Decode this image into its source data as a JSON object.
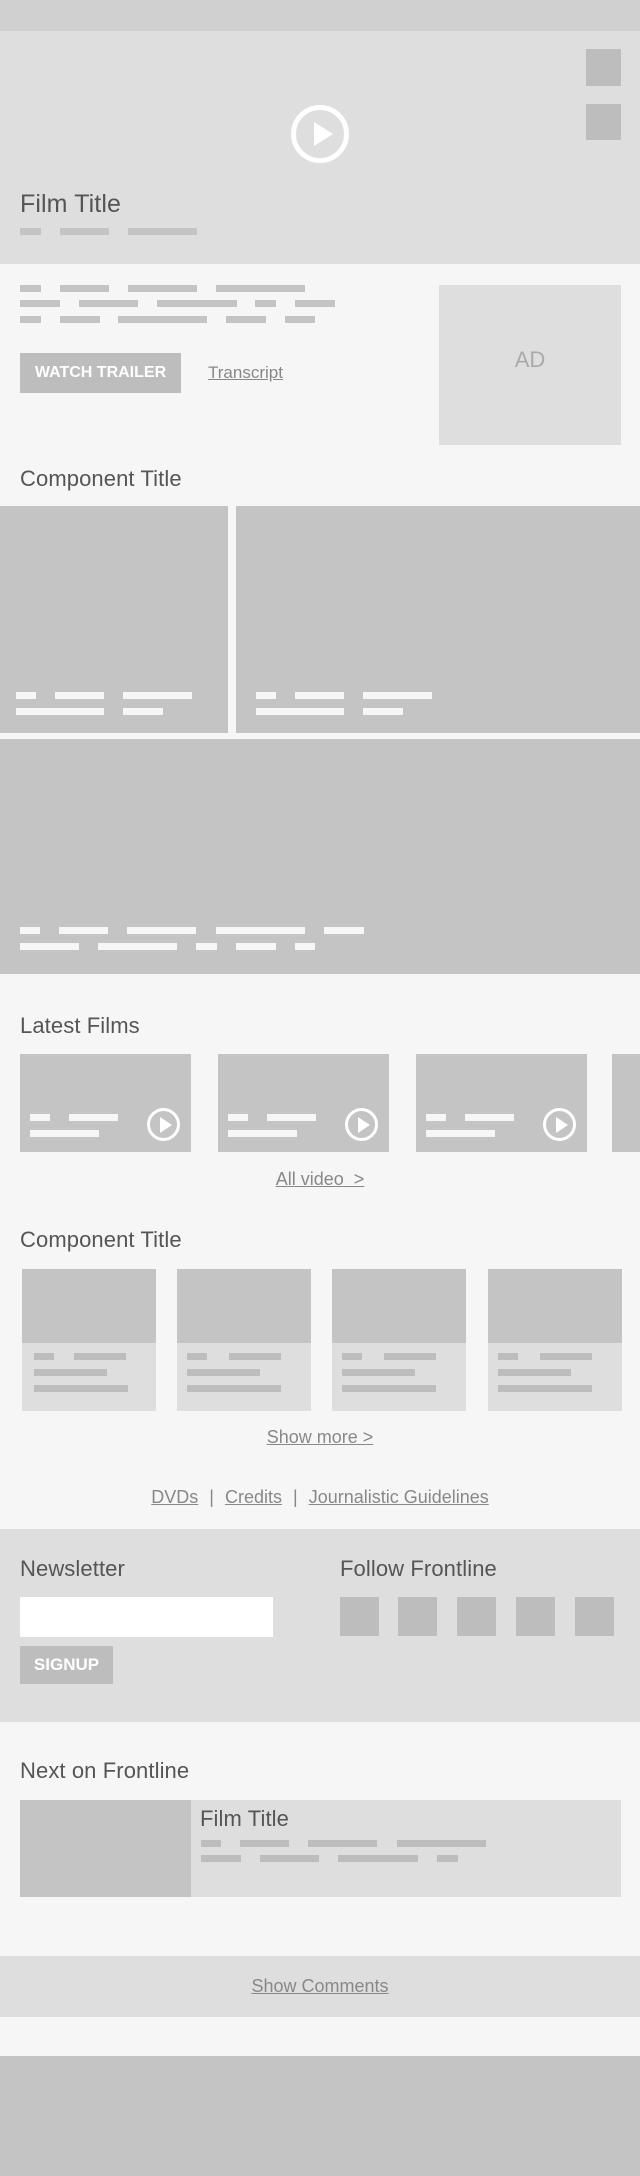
{
  "hero": {
    "film_title": "Film Title"
  },
  "intro": {
    "watch_trailer": "WATCH TRAILER",
    "transcript": "Transcript",
    "ad": "AD"
  },
  "component1": {
    "title": "Component Title"
  },
  "latest": {
    "title": "Latest Films",
    "all_video": "All video  >"
  },
  "component2": {
    "title": "Component Title",
    "show_more": "Show more >"
  },
  "footer_links": {
    "dvds": "DVDs",
    "credits": "Credits",
    "guidelines": "Journalistic Guidelines",
    "sep": "|"
  },
  "newsletter": {
    "title": "Newsletter",
    "signup": "SIGNUP",
    "input_value": ""
  },
  "follow": {
    "title": "Follow Frontline"
  },
  "next": {
    "title": "Next on Frontline",
    "film_title": "Film Title"
  },
  "comments": {
    "label": "Show Comments"
  },
  "colors": {
    "dark_block": "#c4c4c4",
    "light_block": "#dedede",
    "bg": "#f6f6f6",
    "button": "#bdbdbd"
  }
}
